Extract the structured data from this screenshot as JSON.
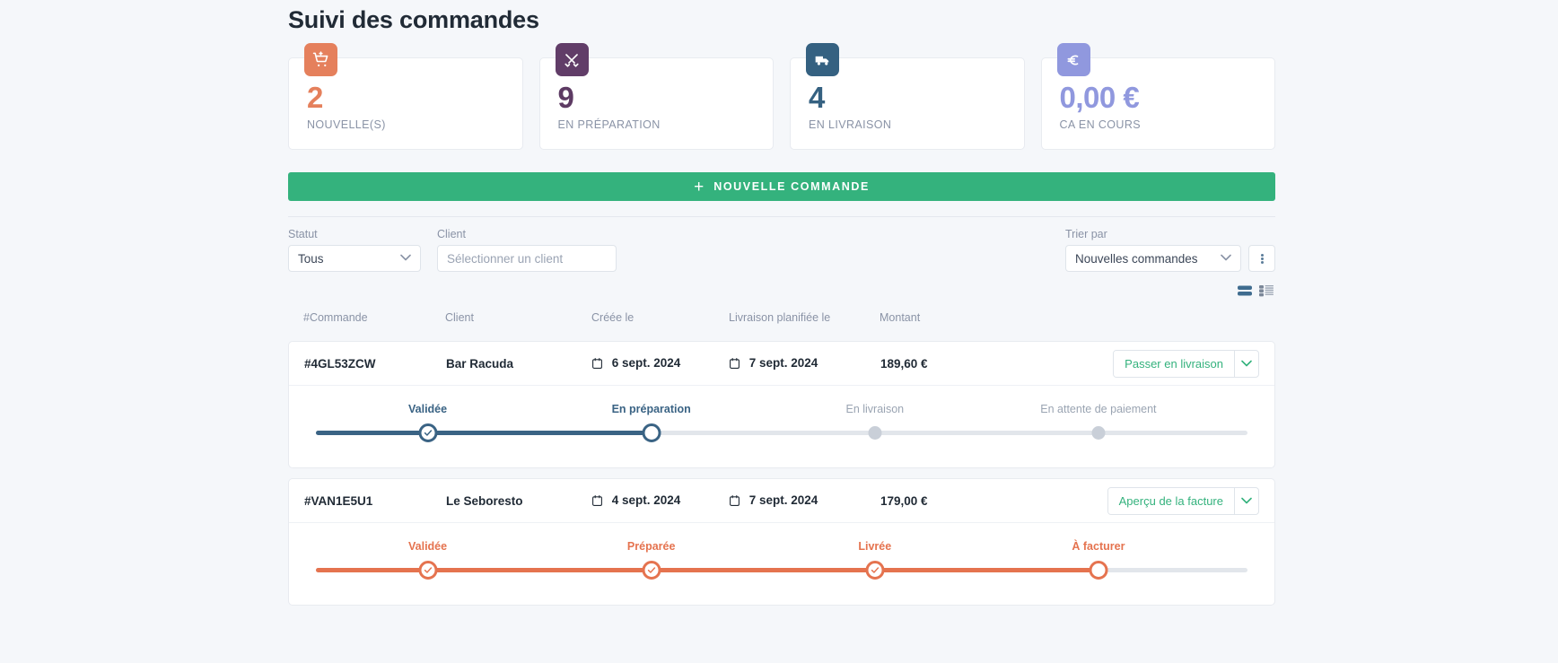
{
  "header": {
    "title": "Suivi des commandes"
  },
  "stats": [
    {
      "value": "2",
      "label": "NOUVELLE(S)",
      "icon": "cart-add-icon",
      "color": "#e5805c",
      "bg": "#e5805c"
    },
    {
      "value": "9",
      "label": "EN PRÉPARATION",
      "icon": "tools-icon",
      "color": "#5d3a63",
      "bg": "#613d68"
    },
    {
      "value": "4",
      "label": "EN LIVRAISON",
      "icon": "truck-icon",
      "color": "#356181",
      "bg": "#356181"
    },
    {
      "value": "0,00 €",
      "label": "CA EN COURS",
      "icon": "euro-icon",
      "color": "#9098de",
      "bg": "#9098de"
    }
  ],
  "primary_action": {
    "label": "NOUVELLE COMMANDE",
    "icon": "plus-icon",
    "color": "#34b27d"
  },
  "filters": {
    "statut": {
      "label": "Statut",
      "value": "Tous"
    },
    "client": {
      "label": "Client",
      "placeholder": "Sélectionner un client",
      "value": ""
    },
    "trier_par": {
      "label": "Trier par",
      "value": "Nouvelles commandes"
    },
    "more_icon": "kebab-menu-icon"
  },
  "view_toggles": [
    {
      "name": "compact-view-icon",
      "active": true
    },
    {
      "name": "list-view-icon",
      "active": false
    }
  ],
  "table": {
    "columns": [
      "#Commande",
      "Client",
      "Créée le",
      "Livraison planifiée le",
      "Montant"
    ],
    "rows": [
      {
        "id": "#4GL53ZCW",
        "client": "Bar Racuda",
        "created": "6 sept. 2024",
        "delivery": "7 sept. 2024",
        "amount": "189,60 €",
        "action": "Passer en livraison",
        "accent": "#34b27d",
        "stepper": {
          "color": "#3a6384",
          "steps": [
            {
              "label": "Validée",
              "state": "done"
            },
            {
              "label": "En préparation",
              "state": "current"
            },
            {
              "label": "En livraison",
              "state": "todo"
            },
            {
              "label": "En attente de paiement",
              "state": "todo"
            }
          ]
        }
      },
      {
        "id": "#VAN1E5U1",
        "client": "Le Seboresto",
        "created": "4 sept. 2024",
        "delivery": "7 sept. 2024",
        "amount": "179,00 €",
        "action": "Aperçu de la facture",
        "accent": "#34b27d",
        "stepper": {
          "color": "#e5734f",
          "steps": [
            {
              "label": "Validée",
              "state": "done"
            },
            {
              "label": "Préparée",
              "state": "done"
            },
            {
              "label": "Livrée",
              "state": "done"
            },
            {
              "label": "À facturer",
              "state": "current"
            }
          ]
        }
      }
    ]
  }
}
